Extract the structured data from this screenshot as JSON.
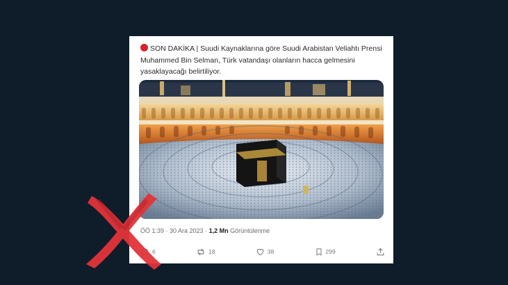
{
  "tweet": {
    "badge_color": "#d8232a",
    "text": "SON DAKİKA | Suudi Kaynaklarına göre Suudi Arabistan Veliahtı Prensi Muhammed Bin Selman, Türk vatandaşı olanların hacca gelmesini yasaklayacağı belirtiliyor.",
    "media_icon": "kaaba-photo",
    "time": "ÖÖ 1:39 · 30 Ara 2023 · ",
    "views_count": "1,2 Mn",
    "views_label": " Görüntülenme"
  },
  "actions": {
    "reply": {
      "icon": "reply-icon",
      "count": "6"
    },
    "retweet": {
      "icon": "retweet-icon",
      "count": "18"
    },
    "like": {
      "icon": "heart-icon",
      "count": "38"
    },
    "bookmark": {
      "icon": "bookmark-icon",
      "count": "299"
    },
    "share": {
      "icon": "share-icon"
    }
  },
  "overlay": {
    "icon": "red-x-mark",
    "color": "#e3343a"
  }
}
